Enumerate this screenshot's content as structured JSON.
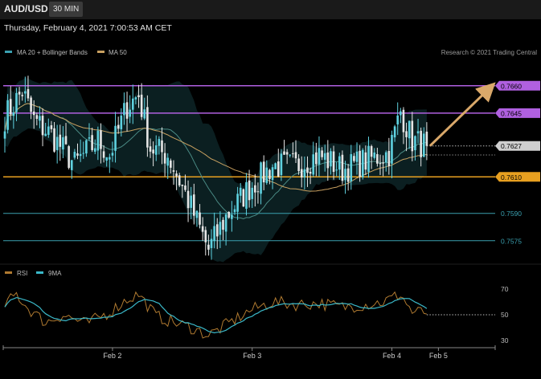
{
  "header": {
    "symbol": "AUD/USD",
    "timeframe": "30 MIN",
    "datetime": "Thursday, February 4, 2021 7:00:53 AM CET"
  },
  "legend": {
    "ma20_bb": "MA 20 + Bollinger Bands",
    "ma50": "MA 50",
    "rsi": "RSI",
    "rsi_ma": "9MA",
    "copyright": "Research © 2021 Trading Central"
  },
  "colors": {
    "bull": "#5fd2e0",
    "bear": "#e6e6e6",
    "ma50": "#c8a060",
    "ma20": "#4a8a84",
    "resistance": "#b060e0",
    "support_orange": "#e8a020",
    "support_teal": "#3aa0b0",
    "arrow": "#d9a86a",
    "rsi": "#b07a30",
    "rsi_ma": "#3ab8c8"
  },
  "chart_data": [
    {
      "type": "candlestick",
      "y_range": [
        0.7563,
        0.7674
      ],
      "levels": [
        {
          "value": 0.766,
          "label": "0.7660",
          "role": "resistance"
        },
        {
          "value": 0.7645,
          "label": "0.7645",
          "role": "resistance"
        },
        {
          "value": 0.7627,
          "label": "0.7627",
          "role": "current"
        },
        {
          "value": 0.761,
          "label": "0.7610",
          "role": "support"
        },
        {
          "value": 0.759,
          "label": "0.7590",
          "role": "support"
        },
        {
          "value": 0.7575,
          "label": "0.7575",
          "role": "support"
        }
      ],
      "projection": {
        "from": 0.7627,
        "to": 0.766
      },
      "x_ticks": [
        {
          "index": 37,
          "label": "Feb 2"
        },
        {
          "index": 85,
          "label": "Feb 3"
        },
        {
          "index": 133,
          "label": "Feb 4"
        },
        {
          "index": 149,
          "label": "Feb 5"
        }
      ],
      "ohlc_path": [
        [
          0,
          0.7643
        ],
        [
          6,
          0.7657
        ],
        [
          10,
          0.7641
        ],
        [
          16,
          0.7633
        ],
        [
          24,
          0.7617
        ],
        [
          32,
          0.763
        ],
        [
          36,
          0.7622
        ],
        [
          42,
          0.7649
        ],
        [
          46,
          0.7655
        ],
        [
          50,
          0.7626
        ],
        [
          56,
          0.7622
        ],
        [
          62,
          0.7601
        ],
        [
          70,
          0.757
        ],
        [
          76,
          0.7588
        ],
        [
          84,
          0.7604
        ],
        [
          92,
          0.7616
        ],
        [
          100,
          0.7616
        ],
        [
          108,
          0.7622
        ],
        [
          116,
          0.7614
        ],
        [
          124,
          0.7619
        ],
        [
          132,
          0.7623
        ],
        [
          136,
          0.7646
        ],
        [
          140,
          0.763
        ],
        [
          145,
          0.7627
        ]
      ]
    },
    {
      "type": "line",
      "name": "RSI",
      "y_range": [
        25,
        75
      ],
      "y_ticks": [
        70,
        50,
        30
      ],
      "reference_line": 50,
      "rsi_path": [
        [
          0,
          58
        ],
        [
          4,
          66
        ],
        [
          8,
          55
        ],
        [
          14,
          44
        ],
        [
          20,
          50
        ],
        [
          28,
          43
        ],
        [
          36,
          52
        ],
        [
          42,
          62
        ],
        [
          46,
          66
        ],
        [
          52,
          49
        ],
        [
          58,
          44
        ],
        [
          64,
          40
        ],
        [
          70,
          34
        ],
        [
          76,
          42
        ],
        [
          84,
          53
        ],
        [
          92,
          60
        ],
        [
          100,
          58
        ],
        [
          108,
          59
        ],
        [
          116,
          56
        ],
        [
          124,
          58
        ],
        [
          130,
          60
        ],
        [
          136,
          66
        ],
        [
          140,
          52
        ],
        [
          145,
          52
        ]
      ]
    }
  ]
}
